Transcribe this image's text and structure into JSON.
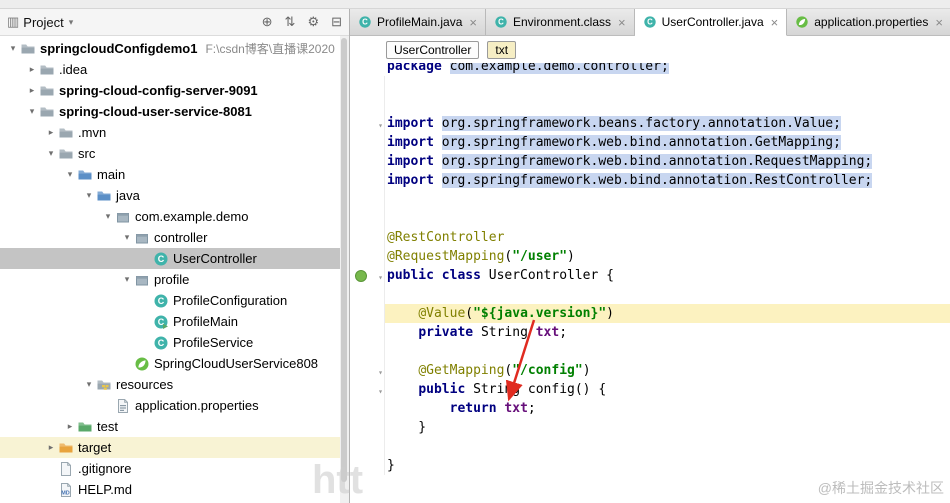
{
  "colors": {
    "keyword": "#000080",
    "annotation": "#808000",
    "string": "#008000",
    "field": "#660E7A",
    "current_line_highlight": "#fcf2c0",
    "import_highlight": "#c8d6f0",
    "tree_selection": "#c4c4c4",
    "tree_row_highlight": "#f8f3d4",
    "annotation_arrow": "#e02b20",
    "spring_green": "#68bd45",
    "class_icon_teal": "#3fb3aa"
  },
  "glyphs": {
    "tool_window": "▥",
    "caret_down": "▾",
    "chevron_down": "▾",
    "chevron_right": "▸",
    "fold": "▾",
    "close": "×"
  },
  "project_panel": {
    "title": "Project",
    "header_icons": [
      {
        "name": "locate-icon",
        "glyph": "⊕"
      },
      {
        "name": "scroll-from-source-icon",
        "glyph": "⇅"
      },
      {
        "name": "settings-icon",
        "glyph": "⚙"
      },
      {
        "name": "hide-panel-icon",
        "glyph": "⊟"
      }
    ],
    "tree": [
      {
        "level": 0,
        "arrow": "down",
        "icon": "folder",
        "label": "springcloudConfigdemo1",
        "path": "F:\\csdn博客\\直播课2020",
        "bold": true
      },
      {
        "level": 1,
        "arrow": "right",
        "icon": "folder",
        "label": ".idea"
      },
      {
        "level": 1,
        "arrow": "right",
        "icon": "folder",
        "label": "spring-cloud-config-server-9091",
        "bold": true
      },
      {
        "level": 1,
        "arrow": "down",
        "icon": "folder",
        "label": "spring-cloud-user-service-8081",
        "bold": true
      },
      {
        "level": 2,
        "arrow": "right",
        "icon": "folder",
        "label": ".mvn"
      },
      {
        "level": 2,
        "arrow": "down",
        "icon": "folder",
        "label": "src"
      },
      {
        "level": 3,
        "arrow": "down",
        "icon": "folder-src",
        "label": "main"
      },
      {
        "level": 4,
        "arrow": "down",
        "icon": "folder-src",
        "label": "java"
      },
      {
        "level": 5,
        "arrow": "down",
        "icon": "package",
        "label": "com.example.demo"
      },
      {
        "level": 6,
        "arrow": "down",
        "icon": "package",
        "label": "controller"
      },
      {
        "level": 7,
        "arrow": null,
        "icon": "class",
        "label": "UserController",
        "selected": true
      },
      {
        "level": 6,
        "arrow": "down",
        "icon": "package",
        "label": "profile"
      },
      {
        "level": 7,
        "arrow": null,
        "icon": "class",
        "label": "ProfileConfiguration"
      },
      {
        "level": 7,
        "arrow": null,
        "icon": "class-run",
        "label": "ProfileMain"
      },
      {
        "level": 7,
        "arrow": null,
        "icon": "class",
        "label": "ProfileService"
      },
      {
        "level": 6,
        "arrow": null,
        "icon": "spring",
        "label": "SpringCloudUserService808"
      },
      {
        "level": 4,
        "arrow": "down",
        "icon": "folder-resources",
        "label": "resources"
      },
      {
        "level": 5,
        "arrow": null,
        "icon": "properties",
        "label": "application.properties"
      },
      {
        "level": 3,
        "arrow": "right",
        "icon": "folder-test",
        "label": "test"
      },
      {
        "level": 2,
        "arrow": "right",
        "icon": "folder-excluded",
        "label": "target",
        "highlight": true
      },
      {
        "level": 2,
        "arrow": null,
        "icon": "file",
        "label": ".gitignore"
      },
      {
        "level": 2,
        "arrow": null,
        "icon": "md",
        "label": "HELP.md"
      }
    ]
  },
  "editor": {
    "tabs": [
      {
        "label": "ProfileMain.java",
        "icon": "class",
        "active": false
      },
      {
        "label": "Environment.class",
        "icon": "class",
        "active": false
      },
      {
        "label": "UserController.java",
        "icon": "class",
        "active": true
      },
      {
        "label": "application.properties",
        "icon": "spring",
        "active": false
      }
    ],
    "chips": [
      "UserController",
      "txt"
    ],
    "code": [
      {
        "clip": true,
        "segs": [
          [
            "package ",
            "kw"
          ],
          [
            "com.example.demo.controller;",
            "imp"
          ]
        ]
      },
      {
        "segs": []
      },
      {
        "segs": []
      },
      {
        "fold": true,
        "segs": [
          [
            "import ",
            "kw"
          ],
          [
            "org.springframework.beans.factory.annotation.Value;",
            "imp"
          ]
        ]
      },
      {
        "segs": [
          [
            "import ",
            "kw"
          ],
          [
            "org.springframework.web.bind.annotation.GetMapping;",
            "imp"
          ]
        ]
      },
      {
        "segs": [
          [
            "import ",
            "kw"
          ],
          [
            "org.springframework.web.bind.annotation.RequestMapping;",
            "imp"
          ]
        ]
      },
      {
        "segs": [
          [
            "import ",
            "kw"
          ],
          [
            "org.springframework.web.bind.annotation.RestController;",
            "imp"
          ]
        ]
      },
      {
        "segs": []
      },
      {
        "segs": []
      },
      {
        "segs": [
          [
            "@RestController",
            "ann"
          ]
        ]
      },
      {
        "segs": [
          [
            "@RequestMapping",
            "ann"
          ],
          [
            "(",
            "pln"
          ],
          [
            "\"/user\"",
            "str"
          ],
          [
            ")",
            "pln"
          ]
        ]
      },
      {
        "fold": true,
        "gutter": "bean",
        "segs": [
          [
            "public class ",
            "kw"
          ],
          [
            "UserController {",
            "pln"
          ]
        ]
      },
      {
        "segs": []
      },
      {
        "hl": true,
        "segs": [
          [
            "    ",
            "pln"
          ],
          [
            "@Value",
            "ann"
          ],
          [
            "(",
            "pln"
          ],
          [
            "\"${java.version}\"",
            "str"
          ],
          [
            ")",
            "pln"
          ]
        ]
      },
      {
        "segs": [
          [
            "    ",
            "pln"
          ],
          [
            "private ",
            "kw"
          ],
          [
            "String ",
            "pln"
          ],
          [
            "txt",
            "fld"
          ],
          [
            ";",
            "pln"
          ]
        ]
      },
      {
        "segs": []
      },
      {
        "fold": true,
        "segs": [
          [
            "    ",
            "pln"
          ],
          [
            "@GetMapping",
            "ann"
          ],
          [
            "(",
            "pln"
          ],
          [
            "\"/config\"",
            "str"
          ],
          [
            ")",
            "pln"
          ]
        ]
      },
      {
        "fold": true,
        "segs": [
          [
            "    ",
            "pln"
          ],
          [
            "public ",
            "kw"
          ],
          [
            "String config() {",
            "pln"
          ]
        ]
      },
      {
        "segs": [
          [
            "        ",
            "pln"
          ],
          [
            "return ",
            "kw"
          ],
          [
            "txt",
            "fld"
          ],
          [
            ";",
            "pln"
          ]
        ]
      },
      {
        "segs": [
          [
            "    }",
            "pln"
          ]
        ]
      },
      {
        "segs": []
      },
      {
        "segs": [
          [
            "}",
            "pln"
          ]
        ]
      }
    ]
  },
  "watermarks": {
    "partial": "htt",
    "community": "@稀土掘金技术社区"
  }
}
